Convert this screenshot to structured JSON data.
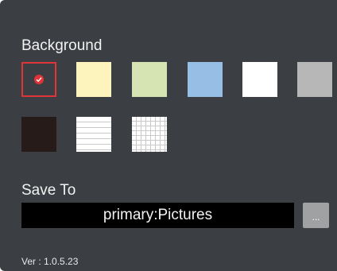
{
  "background_section": {
    "title": "Background",
    "swatches": [
      {
        "name": "selected",
        "color": "#3b3e42",
        "selected": true
      },
      {
        "name": "cream",
        "color": "#fdf3bc",
        "selected": false
      },
      {
        "name": "light-green",
        "color": "#d6e4b4",
        "selected": false
      },
      {
        "name": "light-blue",
        "color": "#97bfe6",
        "selected": false
      },
      {
        "name": "white",
        "color": "#ffffff",
        "selected": false
      },
      {
        "name": "gray",
        "color": "#b7b7b7",
        "selected": false
      },
      {
        "name": "dark-brown",
        "color": "#261b18",
        "selected": false
      },
      {
        "name": "lined-paper",
        "color": "#ffffff",
        "selected": false
      },
      {
        "name": "grid-paper",
        "color": "#ffffff",
        "selected": false
      }
    ],
    "selected_indicator_color": "#e03438"
  },
  "save_section": {
    "title": "Save To",
    "path_value": "primary:Pictures",
    "browse_label": "..."
  },
  "version_text": "Ver : 1.0.5.23",
  "colors": {
    "panel_background": "#3b3e42",
    "text": "#f2f2f2",
    "path_field_background": "#000000",
    "browse_button": "#9fa1a3",
    "accent": "#e03438"
  }
}
